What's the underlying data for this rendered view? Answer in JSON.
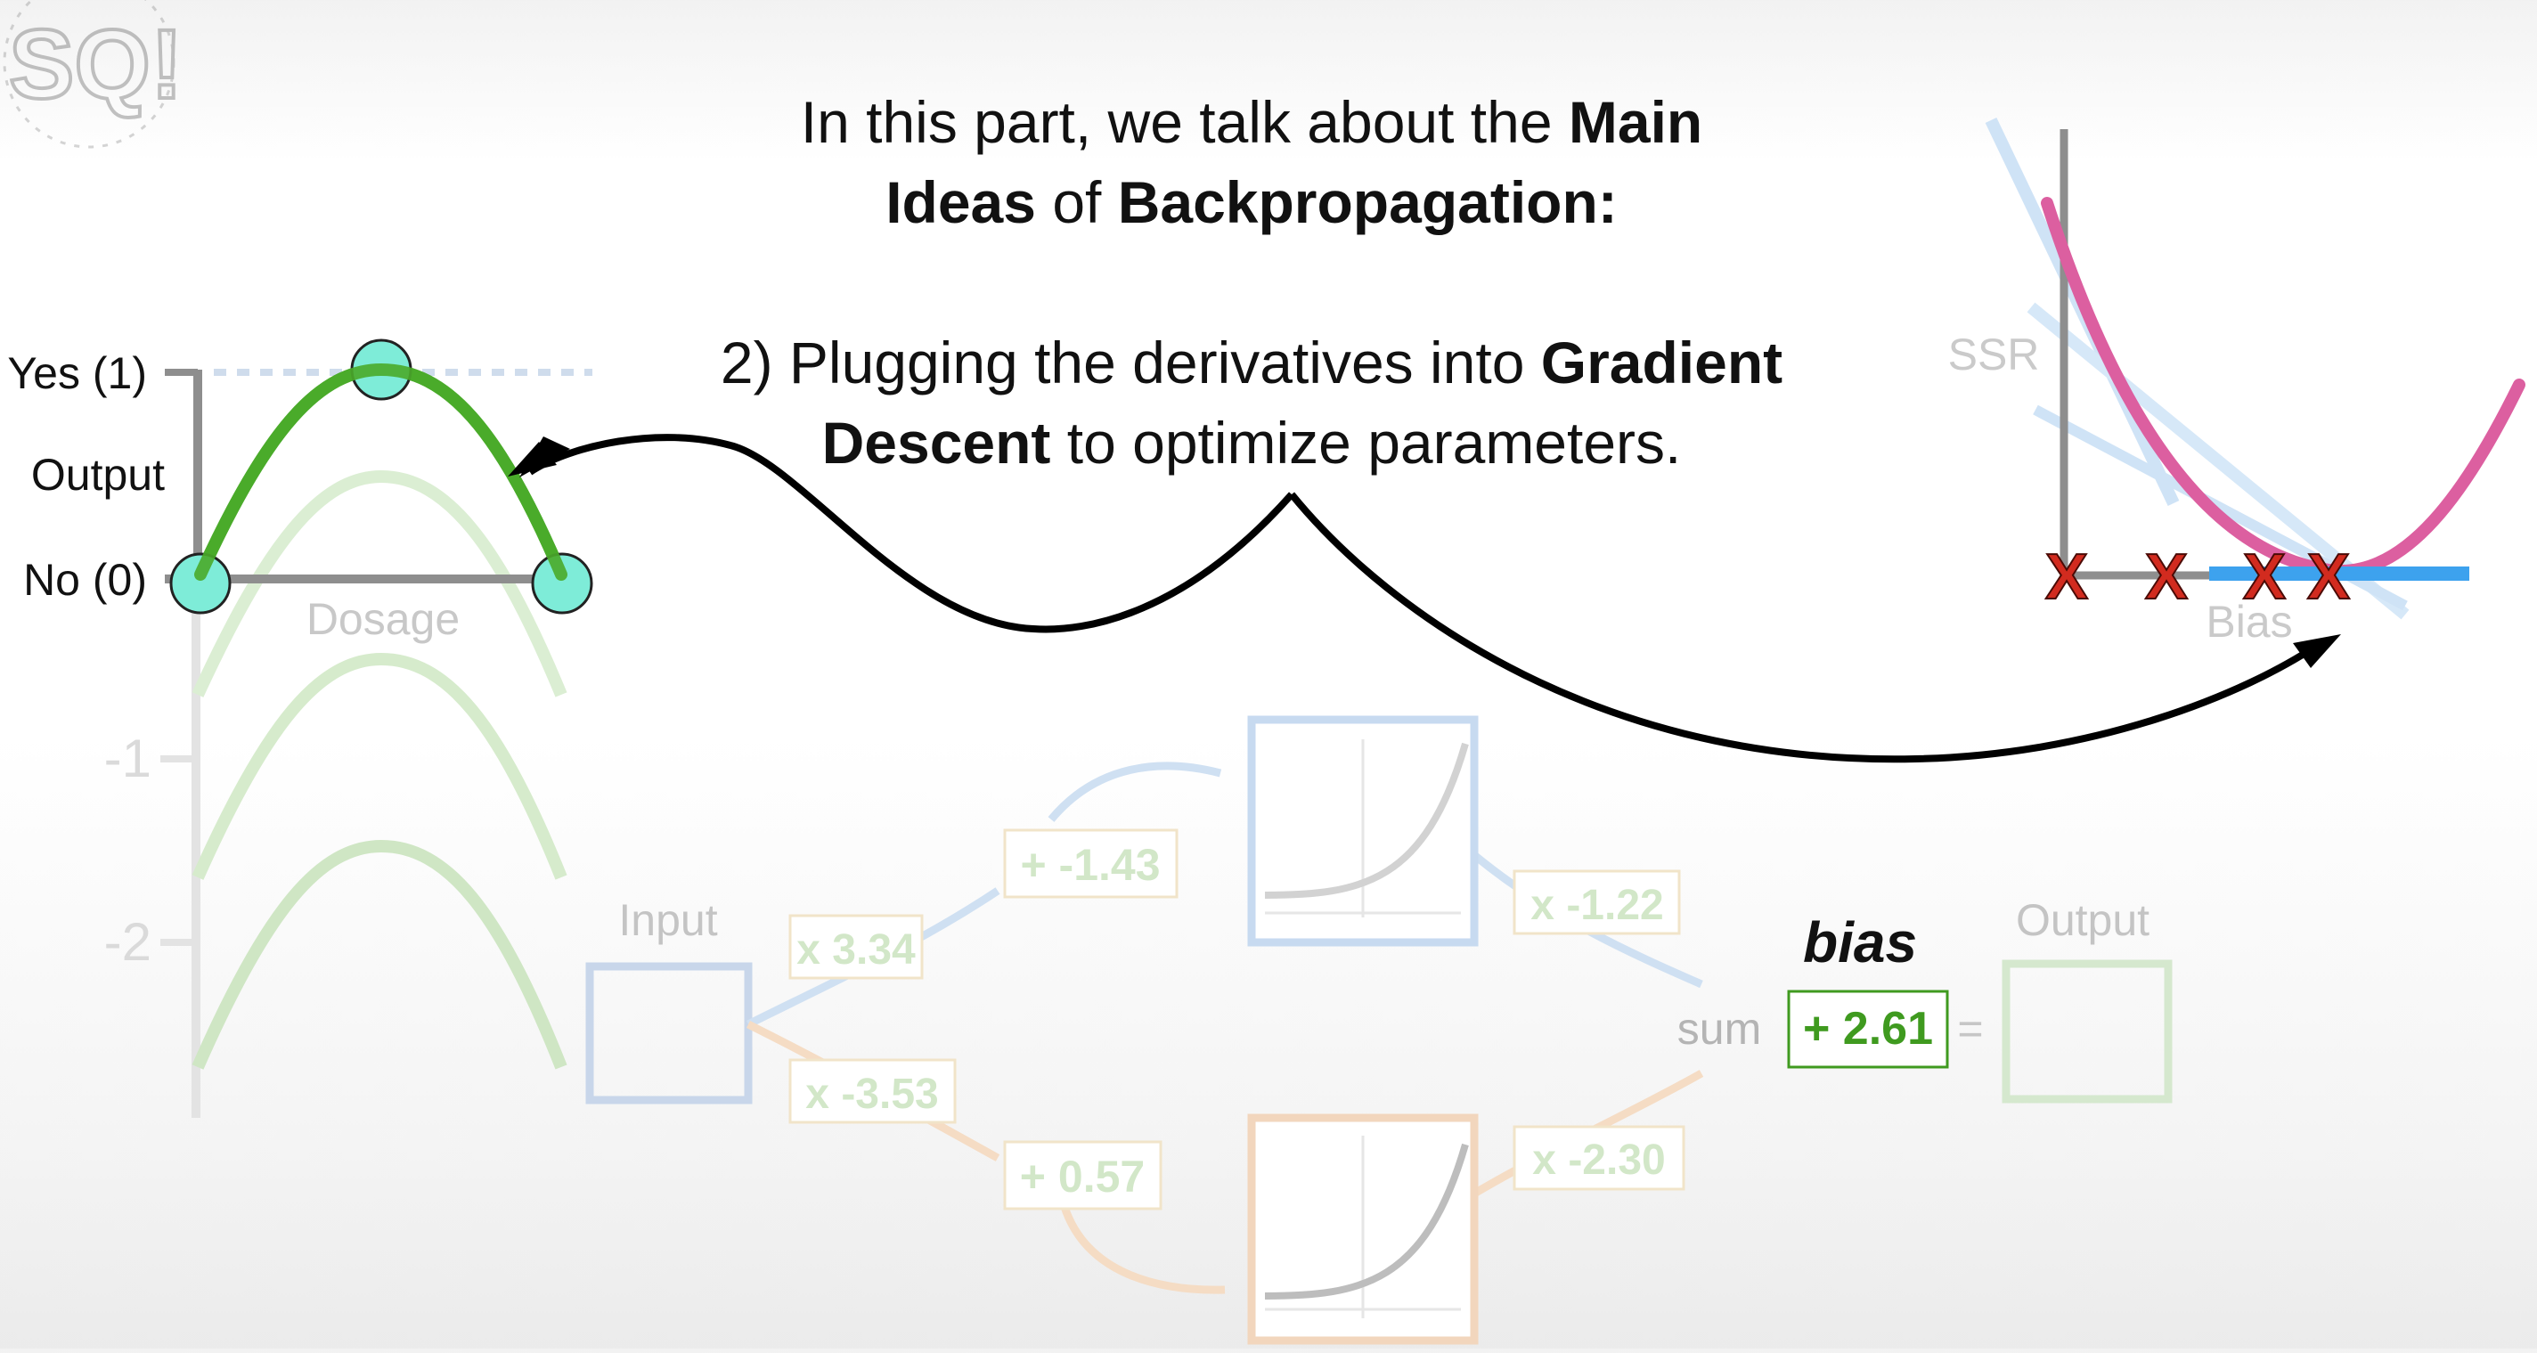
{
  "headline": {
    "line1_pre": "In this part, we talk about the ",
    "line1_bold_a": "Main",
    "line1_bold_b": "Ideas",
    "line1_mid": " of ",
    "line1_bold_c": "Backpropagation:",
    "line2_pre": "2) Plugging the derivatives into ",
    "line2_bold_a": "Gradient",
    "line2_bold_b": "Descent",
    "line2_post": " to optimize parameters."
  },
  "output_plot": {
    "y_top_label": "Yes (1)",
    "y_mid_label": "Output",
    "y_zero_label": "No (0)",
    "x_label": "Dosage",
    "y_neg1": "-1",
    "y_neg2": "-2"
  },
  "network": {
    "input_label": "Input",
    "w1": "x 3.34",
    "w2": "x -3.53",
    "b1": "+ -1.43",
    "b2": "+ 0.57",
    "w3": "x -1.22",
    "w4": "x -2.30",
    "sum_label": "sum",
    "bias_label": "bias",
    "bias_value": "+ 2.61",
    "equals": "=",
    "output_label": "Output"
  },
  "ssr_plot": {
    "y_label": "SSR",
    "x_label": "Bias",
    "marker": "X"
  },
  "colors": {
    "green_curve": "#4aab2a",
    "pale_green": "#c9e6bf",
    "cyan_points": "#7eecd8",
    "pink_curve": "#dc5fa0",
    "blue_line": "#3da2ee",
    "red_x": "#d22b1f",
    "faded_blue": "#b8cfe8",
    "faded_orange": "#f2cfae",
    "bias_green": "#3f9a1f"
  },
  "logo": {
    "text": "SQ!"
  }
}
